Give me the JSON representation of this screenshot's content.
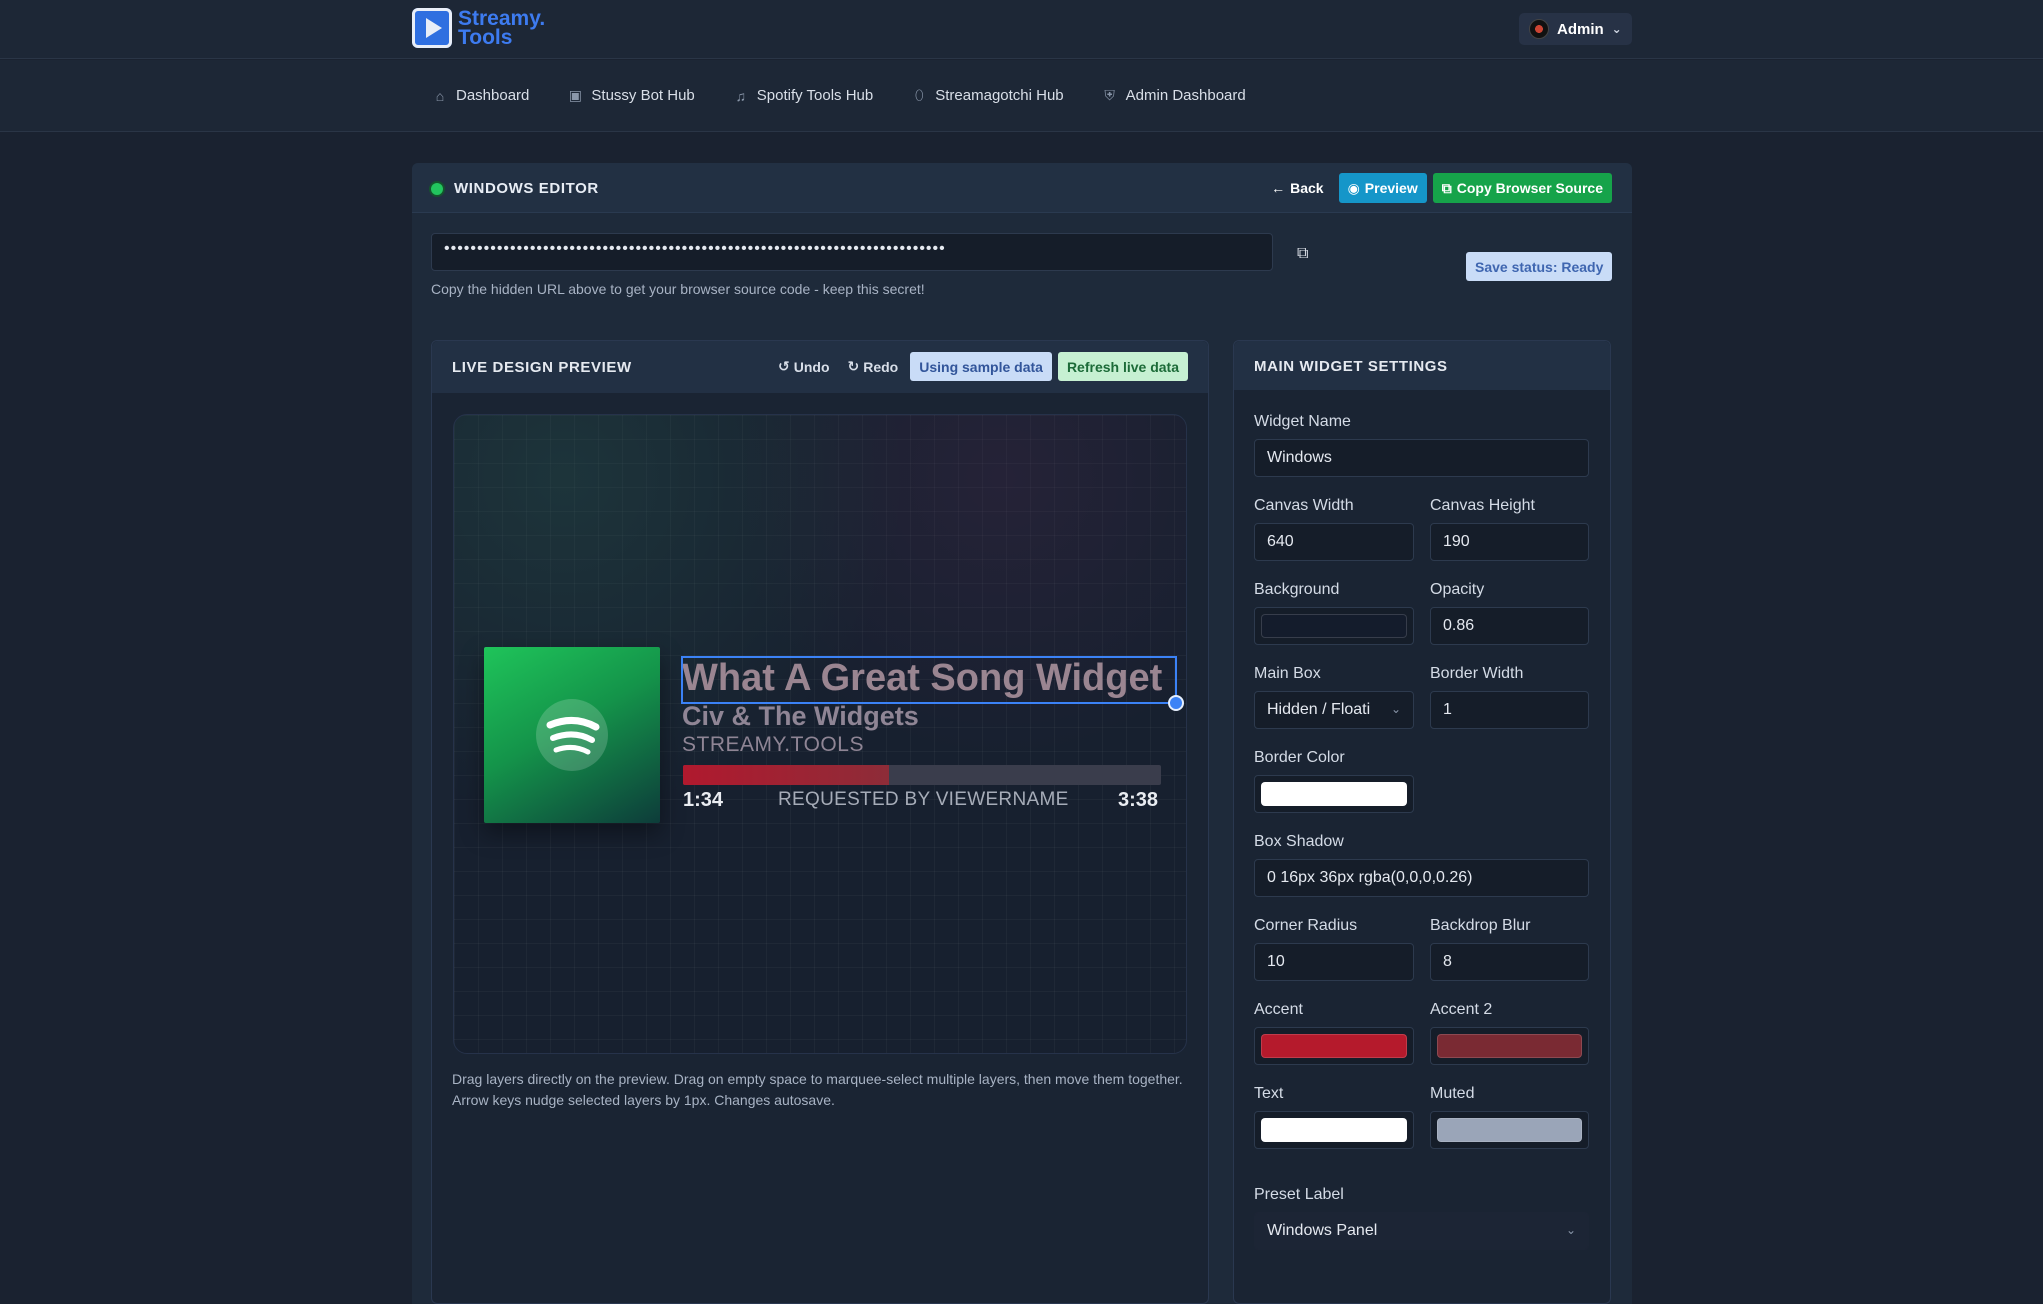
{
  "brand": {
    "name_line1": "Streamy.",
    "name_line2": "Tools"
  },
  "user": {
    "name": "Admin"
  },
  "nav": [
    {
      "label": "Dashboard",
      "icon": "home-icon"
    },
    {
      "label": "Stussy Bot Hub",
      "icon": "robot-icon"
    },
    {
      "label": "Spotify Tools Hub",
      "icon": "music-note-icon"
    },
    {
      "label": "Streamagotchi Hub",
      "icon": "egg-icon"
    },
    {
      "label": "Admin Dashboard",
      "icon": "shield-icon"
    }
  ],
  "editor": {
    "title": "WINDOWS EDITOR",
    "back_label": "Back",
    "preview_label": "Preview",
    "copy_source_label": "Copy Browser Source",
    "hidden_url": "••••••••••••••••••••••••••••••••••••••••••••••••••••••••••••••••••••••••••••",
    "url_hint": "Copy the hidden URL above to get your browser source code - keep this secret!",
    "save_status": "Save status: Ready"
  },
  "preview": {
    "title": "LIVE DESIGN PREVIEW",
    "undo_label": "Undo",
    "redo_label": "Redo",
    "sample_label": "Using sample data",
    "refresh_label": "Refresh live data",
    "help": "Drag layers directly on the preview. Drag on empty space to marquee-select multiple layers, then move them together. Arrow keys nudge selected layers by 1px. Changes autosave.",
    "widget": {
      "song_title": "What A Great Song Widget",
      "artist": "Civ & The Widgets",
      "source": "STREAMY.TOOLS",
      "elapsed": "1:34",
      "requested_by": "REQUESTED BY VIEWERNAME",
      "duration": "3:38",
      "progress": 0.43
    }
  },
  "settings": {
    "title": "MAIN WIDGET SETTINGS",
    "widget_name": {
      "label": "Widget Name",
      "value": "Windows"
    },
    "canvas_width": {
      "label": "Canvas Width",
      "value": "640"
    },
    "canvas_height": {
      "label": "Canvas Height",
      "value": "190"
    },
    "background": {
      "label": "Background",
      "color": "#141c2c"
    },
    "opacity": {
      "label": "Opacity",
      "value": "0.86"
    },
    "main_box": {
      "label": "Main Box",
      "value": "Hidden / Floati"
    },
    "border_width": {
      "label": "Border Width",
      "value": "1"
    },
    "border_color": {
      "label": "Border Color",
      "color": "#ffffff"
    },
    "box_shadow": {
      "label": "Box Shadow",
      "value": "0 16px 36px rgba(0,0,0,0.26)"
    },
    "corner_radius": {
      "label": "Corner Radius",
      "value": "10"
    },
    "backdrop_blur": {
      "label": "Backdrop Blur",
      "value": "8"
    },
    "accent": {
      "label": "Accent",
      "color": "#b51a2c"
    },
    "accent2": {
      "label": "Accent 2",
      "color": "#7a2a33"
    },
    "text": {
      "label": "Text",
      "color": "#ffffff"
    },
    "muted": {
      "label": "Muted",
      "color": "#9aa5b8"
    },
    "preset_label": {
      "label": "Preset Label",
      "value": "Windows Panel"
    }
  }
}
